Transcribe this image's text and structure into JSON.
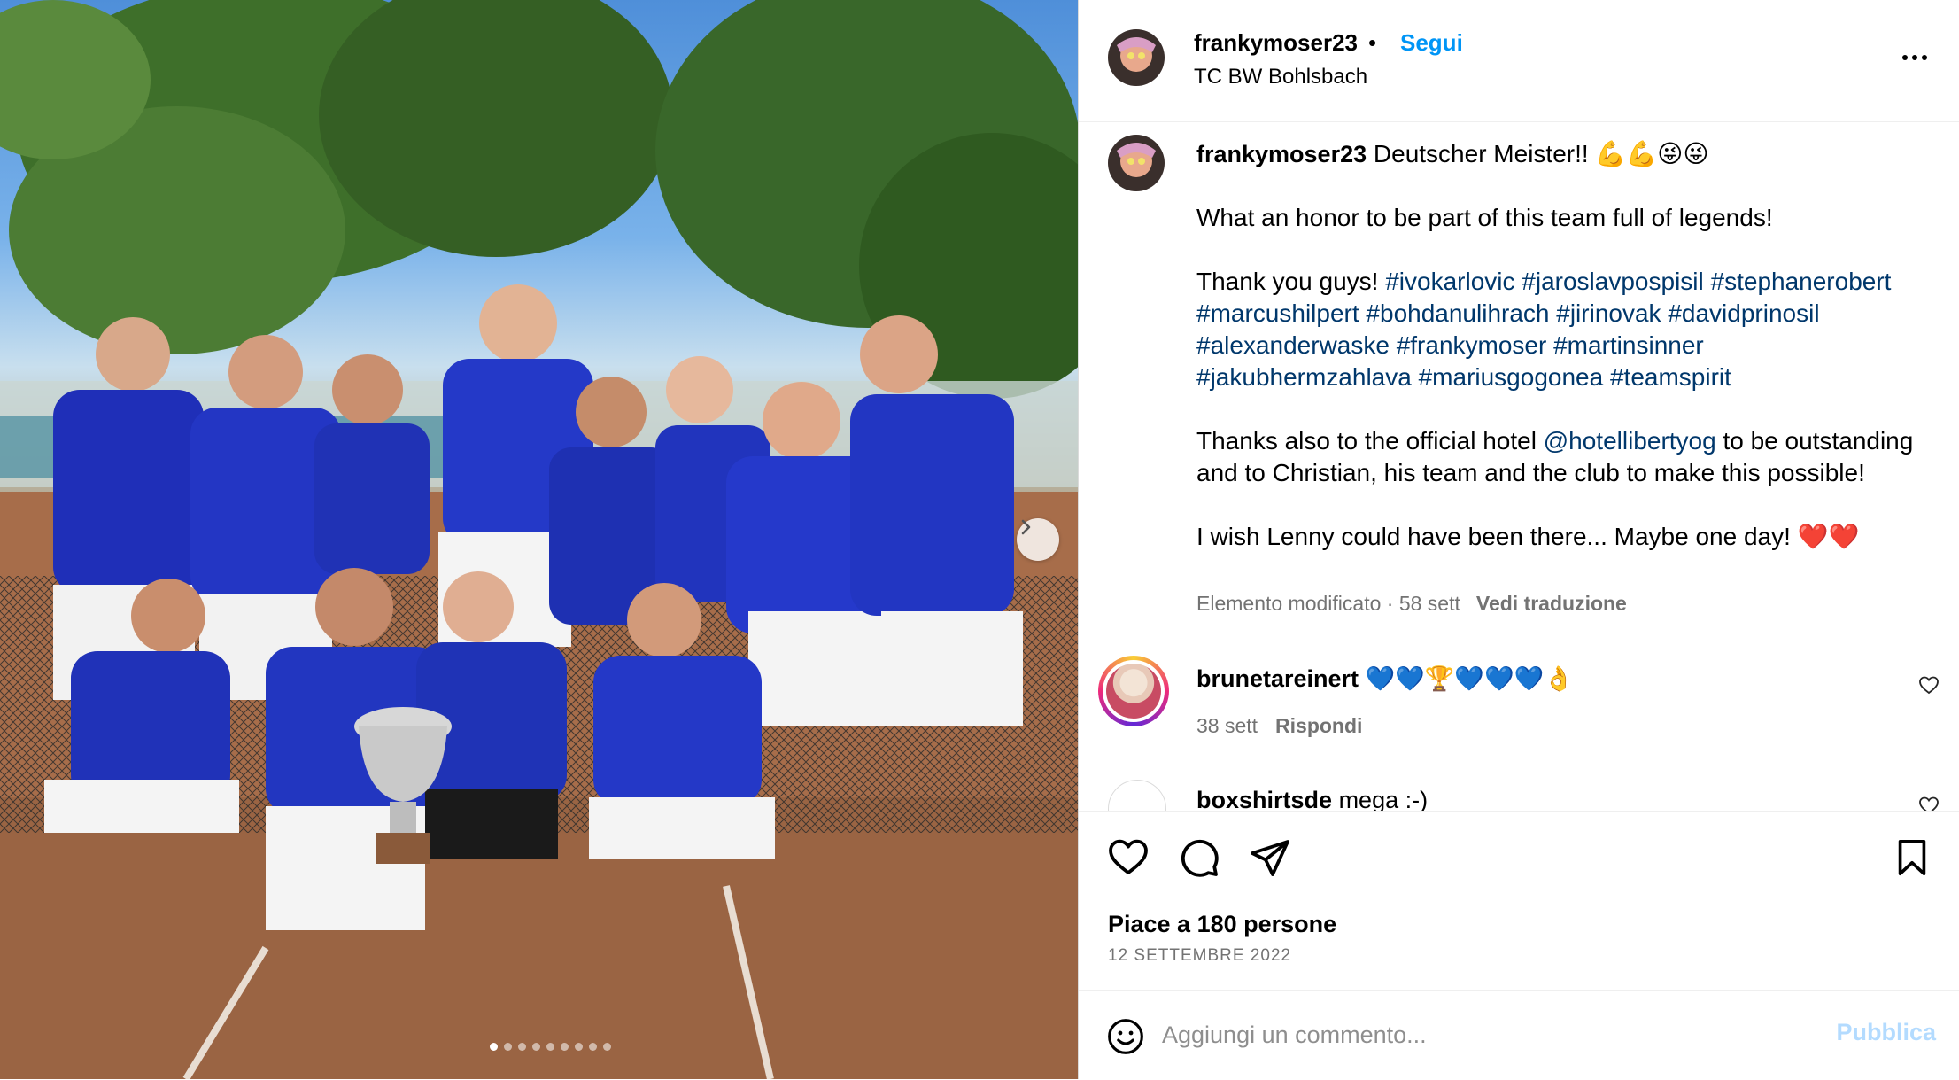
{
  "post": {
    "username": "frankymoser23",
    "follow_label": "Segui",
    "bullet": "•",
    "location": "TC BW Bohlsbach"
  },
  "caption": {
    "username": "frankymoser23",
    "line1": "Deutscher Meister!! 💪💪😜😜",
    "line2": "What an honor to be part of this team full of legends!",
    "line3_intro": "Thank you guys!",
    "hashtags": [
      "#ivokarlovic",
      "#jaroslavpospisil",
      "#stephanerobert",
      "#marcushilpert",
      "#bohdanulihrach",
      "#jirinovak",
      "#davidprinosil",
      "#alexanderwaske",
      "#frankymoser",
      "#martinsinner",
      "#jakubhermzahlava",
      "#mariusgogonea",
      "#teamspirit"
    ],
    "line4_a": "Thanks also to the official hotel",
    "line4_mention": "@hotellibertyog",
    "line4_b": "to be outstanding and to Christian, his team and the club to make this possible!",
    "line5": "I wish Lenny could have been there... Maybe one day! ❤️❤️",
    "meta": "Elemento modificato · 58 sett",
    "translate": "Vedi traduzione"
  },
  "comments": [
    {
      "username": "brunetareinert",
      "text": "💙💙🏆💙💙💙👌",
      "time": "38 sett",
      "reply": "Rispondi"
    },
    {
      "username": "boxshirtsde",
      "text": "mega :-)"
    }
  ],
  "likes_text": "Piace a 180 persone",
  "date_text": "12 SETTEMBRE 2022",
  "add_comment": {
    "placeholder": "Aggiungi un commento...",
    "publish_label": "Pubblica"
  },
  "carousel": {
    "slides": 9,
    "active": 1
  },
  "colors": {
    "link": "#0095f6",
    "hashtag": "#00376b",
    "secondary": "#737373",
    "publish_disabled": "#b3dbff"
  }
}
